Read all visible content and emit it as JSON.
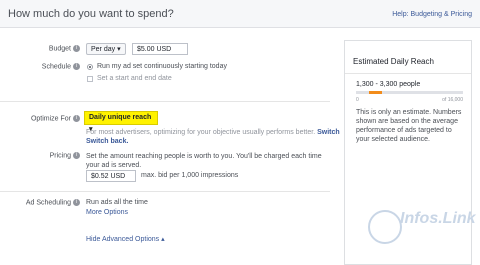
{
  "header": {
    "title": "How much do you want to spend?",
    "help": "Help: Budgeting & Pricing"
  },
  "budget": {
    "label": "Budget",
    "period": "Per day ▾",
    "amount": "$5.00 USD"
  },
  "schedule": {
    "label": "Schedule",
    "options": [
      "Run my ad set continuously starting today",
      "Set a start and end date"
    ]
  },
  "optimize": {
    "label": "Optimize For",
    "selected": "Daily unique reach ▾",
    "hint_prefix": "For most advertisers, optimizing for your objective usually performs better.",
    "hint_link": "Switch back."
  },
  "pricing": {
    "label": "Pricing",
    "description": "Set the amount reaching people is worth to you. You'll be charged each time your ad is served.",
    "bid": "$0.52 USD",
    "bid_suffix": "max. bid per 1,000 impressions"
  },
  "ad_scheduling": {
    "label": "Ad Scheduling",
    "value": "Run ads all the time",
    "more": "More Options"
  },
  "footer": {
    "hide_advanced": "Hide Advanced Options ▴"
  },
  "side": {
    "title": "Estimated Daily Reach",
    "range": "1,300 - 3,300 people",
    "bar_fill_fraction": 0.12,
    "bar_min": "0",
    "bar_max": "of 16,000",
    "note": "This is only an estimate. Numbers shown are based on the average performance of ads targeted to your selected audience."
  },
  "watermark": "Infos.Link",
  "colors": {
    "accent": "#3b5998",
    "highlight": "#fff200",
    "bar": "#f28c1b"
  }
}
